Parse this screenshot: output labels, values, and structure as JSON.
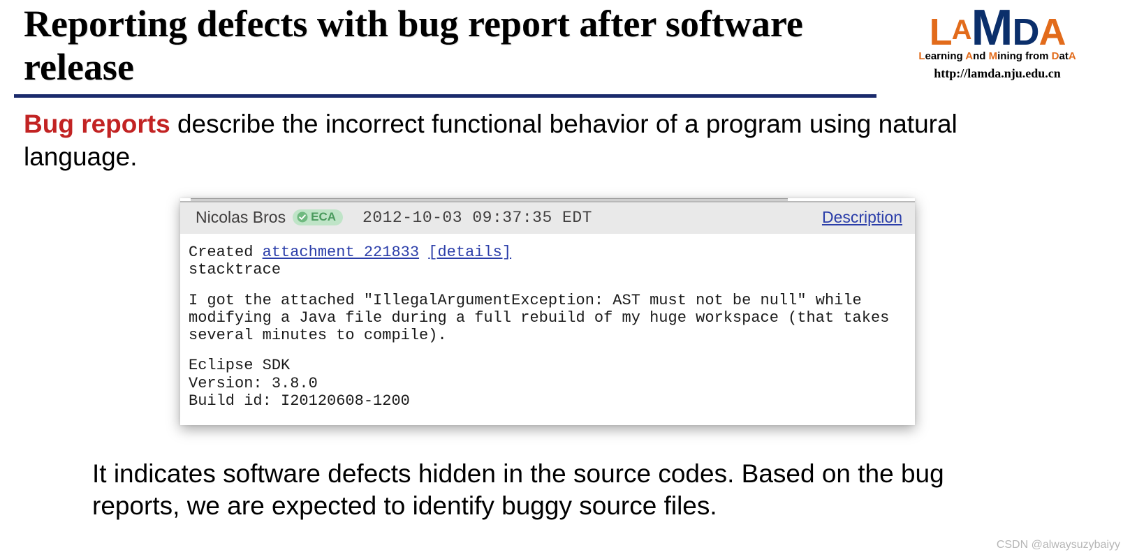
{
  "title": "Reporting defects with bug report after software release",
  "logo": {
    "letters": [
      "L",
      "A",
      "M",
      "D",
      "A"
    ],
    "tagline_prefix": "L",
    "tagline_mid1": "earning ",
    "tagline_a1": "A",
    "tagline_mid2": "nd ",
    "tagline_m": "M",
    "tagline_mid3": "ining from ",
    "tagline_d": "D",
    "tagline_mid4": "at",
    "tagline_a2": "A",
    "url": "http://lamda.nju.edu.cn"
  },
  "intro": {
    "highlight": "Bug reports",
    "rest": " describe the incorrect functional behavior of a program using natural language."
  },
  "bug_report": {
    "author": "Nicolas Bros",
    "badge": "ECA",
    "timestamp": "2012-10-03 09:37:35 EDT",
    "description_label": "Description",
    "created_prefix": "Created ",
    "attachment_text": "attachment 221833",
    "details_text": "[details]",
    "stacktrace": "stacktrace",
    "paragraph": "I got the attached \"IllegalArgumentException: AST must not be null\" while modifying a Java file during a full rebuild of my huge workspace (that takes several minutes to compile).",
    "sdk_line": "Eclipse SDK",
    "version_line": "Version: 3.8.0",
    "build_line": "Build id: I20120608-1200"
  },
  "outro": "It indicates software defects hidden in the source codes. Based on the bug reports, we are expected to identify buggy source files.",
  "watermark": "CSDN @alwaysuzybaiyy"
}
